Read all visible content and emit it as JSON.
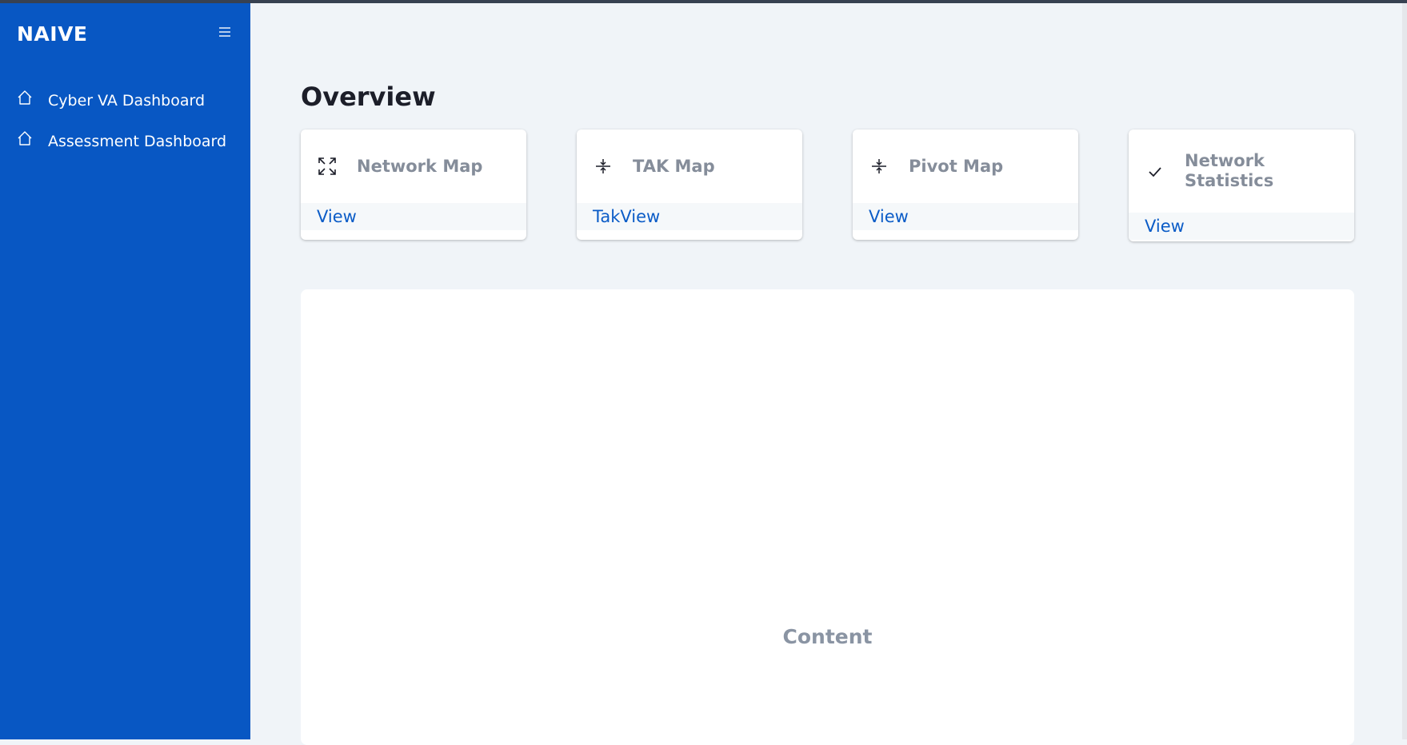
{
  "sidebar": {
    "brand": "NAIVE",
    "menu_icon": "hamburger-icon",
    "items": [
      {
        "label": "Cyber VA Dashboard",
        "icon": "home-icon"
      },
      {
        "label": "Assessment Dashboard",
        "icon": "home-icon"
      }
    ]
  },
  "main": {
    "title": "Overview",
    "cards": [
      {
        "title": "Network Map",
        "link": "View",
        "icon": "expand-arrows-icon"
      },
      {
        "title": "TAK Map",
        "link": "TakView",
        "icon": "collapse-vertical-icon"
      },
      {
        "title": "Pivot Map",
        "link": "View",
        "icon": "collapse-vertical-icon"
      },
      {
        "title": "Network Statistics",
        "link": "View",
        "icon": "check-icon"
      }
    ],
    "content_label": "Content"
  },
  "colors": {
    "sidebar_bg": "#0857c3",
    "page_bg": "#f0f4f8",
    "link": "#0b5cc7",
    "card_title": "#858d9a",
    "heading": "#1c1e29"
  }
}
